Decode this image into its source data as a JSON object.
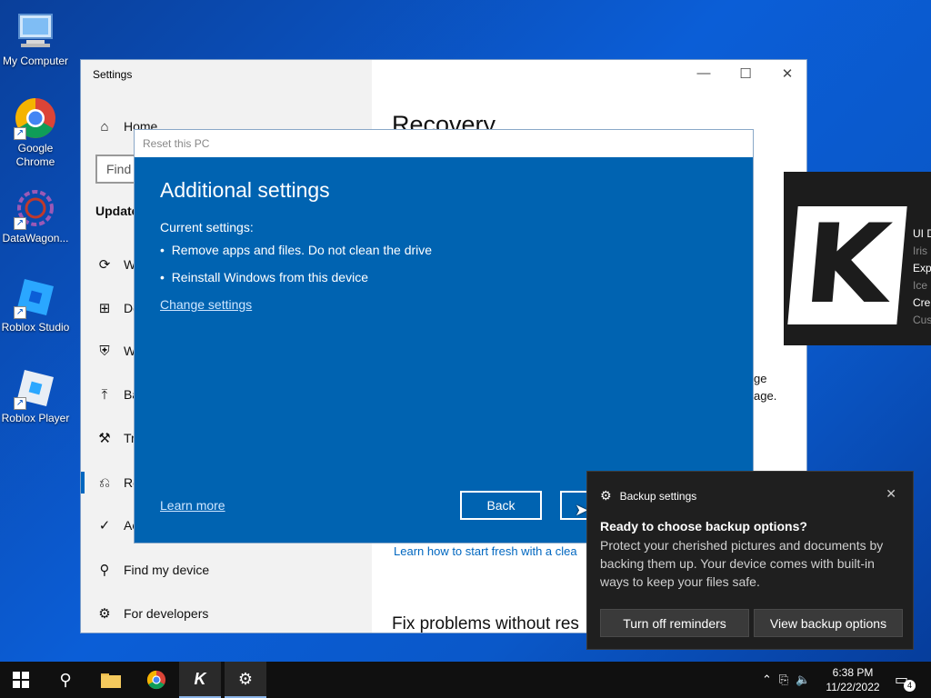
{
  "desktop": {
    "icons": [
      {
        "label": "My Computer",
        "icon": "computer-icon"
      },
      {
        "label": "Google Chrome",
        "icon": "chrome-icon"
      },
      {
        "label": "DataWagon...",
        "icon": "datawagon-icon"
      },
      {
        "label": "Roblox Studio",
        "icon": "roblox-studio-icon"
      },
      {
        "label": "Roblox Player",
        "icon": "roblox-player-icon"
      }
    ]
  },
  "settings": {
    "title": "Settings",
    "search_placeholder": "Find",
    "sidebar": {
      "home": "Home",
      "section_heading": "Update",
      "items": [
        {
          "label": "W",
          "icon": "sync-icon"
        },
        {
          "label": "De",
          "icon": "delivery-icon"
        },
        {
          "label": "W",
          "icon": "shield-icon"
        },
        {
          "label": "Ba",
          "icon": "backup-icon"
        },
        {
          "label": "Tr",
          "icon": "wrench-icon"
        },
        {
          "label": "Re",
          "icon": "recovery-icon"
        },
        {
          "label": "Ac",
          "icon": "check-circle-icon"
        },
        {
          "label": "Find my device",
          "icon": "person-icon"
        },
        {
          "label": "For developers",
          "icon": "developer-icon"
        }
      ]
    },
    "main": {
      "title": "Recovery",
      "text_line_1": "ge",
      "text_line_2": "age.",
      "fresh_link": "Learn how to start fresh with a clea",
      "fix_heading": "Fix problems without res"
    }
  },
  "reset_dialog": {
    "title_bar": "Reset this PC",
    "heading": "Additional settings",
    "current_label": "Current settings:",
    "bullets": [
      "Remove apps and files. Do not clean the drive",
      "Reinstall Windows from this device"
    ],
    "change_link": "Change settings",
    "learn_more": "Learn more",
    "back_button": "Back"
  },
  "overlay_panel": {
    "logo_letter": "K",
    "lines": [
      "UI D",
      "Iris",
      "Exp",
      "Ice",
      "Cre",
      "Cus"
    ]
  },
  "toast": {
    "app_name": "Backup settings",
    "title": "Ready to choose backup options?",
    "body": "Protect your cherished pictures and documents by backing them up. Your device comes with built-in ways to keep your files safe.",
    "button_1": "Turn off reminders",
    "button_2": "View backup options"
  },
  "taskbar": {
    "time": "6:38 PM",
    "date": "11/22/2022",
    "notification_count": "4"
  }
}
